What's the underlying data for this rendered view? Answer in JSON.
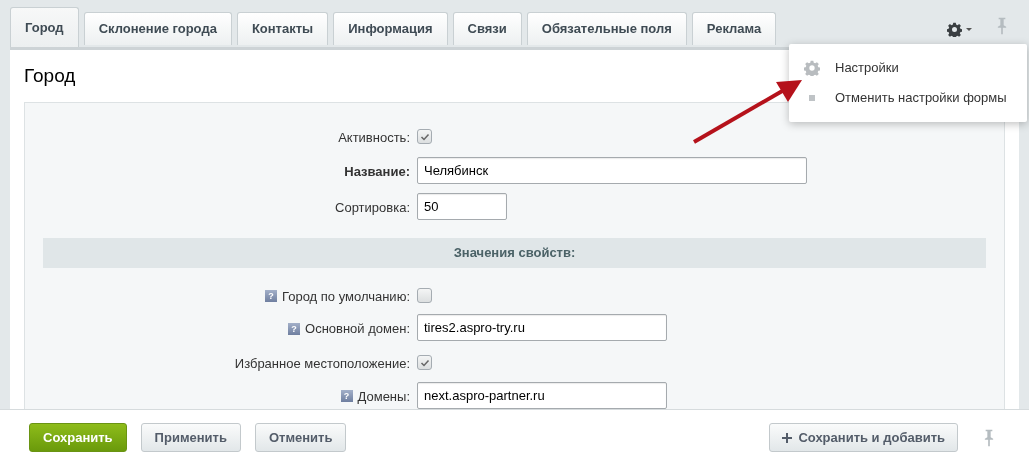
{
  "tabs": [
    {
      "label": "Город",
      "selected": true
    },
    {
      "label": "Склонение города",
      "selected": false
    },
    {
      "label": "Контакты",
      "selected": false
    },
    {
      "label": "Информация",
      "selected": false
    },
    {
      "label": "Связи",
      "selected": false
    },
    {
      "label": "Обязательные поля",
      "selected": false
    },
    {
      "label": "Реклама",
      "selected": false
    }
  ],
  "settings_menu": {
    "expanded": true,
    "items": [
      {
        "label": "Настройки",
        "kind": "gear"
      },
      {
        "label": "Отменить настройки формы",
        "kind": "dot"
      }
    ]
  },
  "section_title": "Город",
  "fields": [
    {
      "kind": "checkbox",
      "label": "Активность:",
      "checked": true,
      "bold": false
    },
    {
      "kind": "wide_text",
      "label": "Название:",
      "value": "Челябинск",
      "bold": true
    },
    {
      "kind": "short_text",
      "label": "Сортировка:",
      "value": "50",
      "bold": false
    }
  ],
  "properties_header": "Значения свойств:",
  "properties": [
    {
      "kind": "checkbox",
      "label": "Город по умолчанию:",
      "checked": false,
      "help_mark": "?",
      "bold": false
    },
    {
      "kind": "text",
      "label": "Основной домен:",
      "value": "tires2.aspro-try.ru",
      "help_mark": "?",
      "bold": false
    },
    {
      "kind": "checkbox",
      "label": "Избранное местоположение:",
      "checked": true,
      "bold": false
    },
    {
      "kind": "text",
      "label": "Домены:",
      "value": "next.aspro-partner.ru",
      "help_mark": "?",
      "bold": false
    }
  ],
  "footer_buttons": [
    {
      "label": "Сохранить",
      "kind": "primary"
    },
    {
      "label": "Применить",
      "kind": "default"
    },
    {
      "label": "Отменить",
      "kind": "default"
    }
  ],
  "save_and_add": {
    "label": "Сохранить и добавить"
  }
}
